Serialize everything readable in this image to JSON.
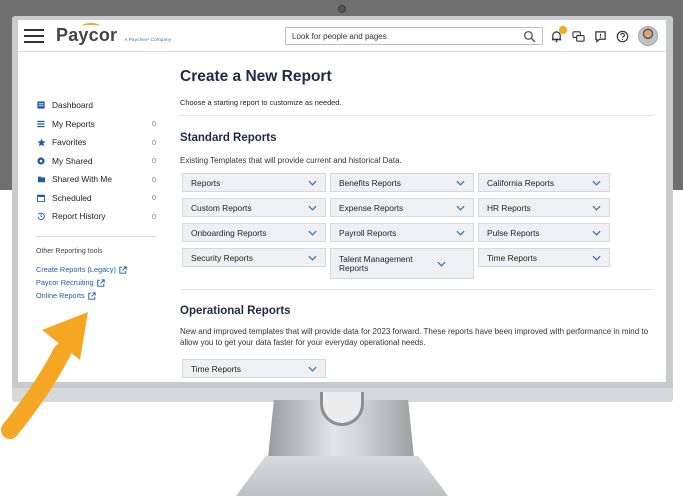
{
  "brand": {
    "name": "Paycor",
    "tagline": "A Paychex² Company",
    "accent": "#f5a623",
    "link": "#1f5ca8",
    "title_color": "#1f2a44"
  },
  "search": {
    "placeholder": "Look for people and pages",
    "icon": "search-icon"
  },
  "header_icons": [
    "bell-icon",
    "chat-icon",
    "message-icon",
    "help-icon",
    "avatar"
  ],
  "sidebar": {
    "items": [
      {
        "label": "Dashboard",
        "icon": "dashboard-icon",
        "count": ""
      },
      {
        "label": "My Reports",
        "icon": "list-icon",
        "count": "0"
      },
      {
        "label": "Favorites",
        "icon": "star-icon",
        "count": "0"
      },
      {
        "label": "My Shared",
        "icon": "share-icon",
        "count": "0"
      },
      {
        "label": "Shared With Me",
        "icon": "folder-icon",
        "count": "0"
      },
      {
        "label": "Scheduled",
        "icon": "calendar-icon",
        "count": "0"
      },
      {
        "label": "Report History",
        "icon": "history-icon",
        "count": "0"
      }
    ],
    "tools_title": "Other Reporting tools",
    "tools": [
      {
        "label": "Create Reports (Legacy)"
      },
      {
        "label": "Paycor Recruiting"
      },
      {
        "label": "Online Reports"
      }
    ]
  },
  "main": {
    "title": "Create a New Report",
    "subtitle": "Choose a starting report to customize as needed.",
    "standard": {
      "title": "Standard Reports",
      "desc": "Existing Templates that will provide current and historical Data.",
      "dropdowns": [
        "Reports",
        "Benefits Reports",
        "California Reports",
        "Custom Reports",
        "Expense Reports",
        "HR Reports",
        "Onboarding Reports",
        "Payroll Reports",
        "Pulse Reports",
        "Security Reports",
        "Talent Management Reports",
        "Time Reports"
      ]
    },
    "operational": {
      "title": "Operational Reports",
      "desc": "New and improved templates that will provide data for 2023 forward. These reports have been improved with performance in mind to allow you to get your data faster for your everyday operational needs.",
      "dropdowns": [
        "Time Reports"
      ]
    }
  }
}
